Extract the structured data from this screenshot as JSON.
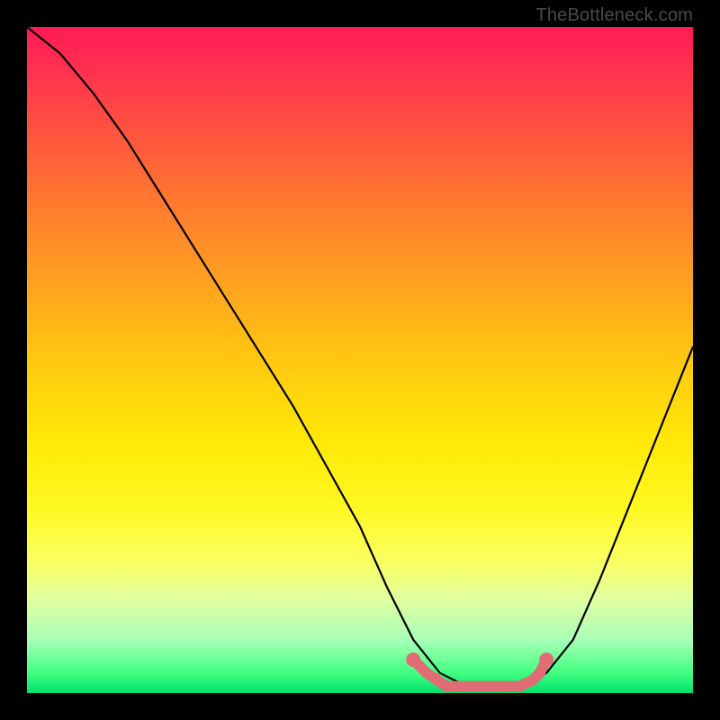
{
  "attribution": "TheBottleneck.com",
  "chart_data": {
    "type": "line",
    "title": "",
    "xlabel": "",
    "ylabel": "",
    "xlim": [
      0,
      100
    ],
    "ylim": [
      0,
      100
    ],
    "gradient_stops": [
      {
        "pos": 0,
        "color": "#ff1a55"
      },
      {
        "pos": 15,
        "color": "#ff5040"
      },
      {
        "pos": 38,
        "color": "#ffa020"
      },
      {
        "pos": 62,
        "color": "#ffe808"
      },
      {
        "pos": 86,
        "color": "#e0ffa0"
      },
      {
        "pos": 100,
        "color": "#00e070"
      }
    ],
    "series": [
      {
        "name": "bottleneck-curve",
        "color": "#000000",
        "x": [
          0,
          5,
          10,
          15,
          20,
          25,
          30,
          35,
          40,
          45,
          50,
          54,
          58,
          62,
          66,
          70,
          74,
          78,
          82,
          86,
          90,
          94,
          98,
          100
        ],
        "y": [
          100,
          96,
          90,
          83,
          75,
          67,
          59,
          51,
          43,
          34,
          25,
          16,
          8,
          3,
          1,
          1,
          1,
          3,
          8,
          17,
          27,
          37,
          47,
          52
        ]
      },
      {
        "name": "optimal-range-marker",
        "color": "#e06c75",
        "x": [
          58,
          60,
          63,
          66,
          69,
          72,
          74,
          76,
          77,
          78
        ],
        "y": [
          5,
          3,
          1,
          1,
          1,
          1,
          1,
          2,
          3,
          5
        ]
      }
    ],
    "annotations": []
  }
}
